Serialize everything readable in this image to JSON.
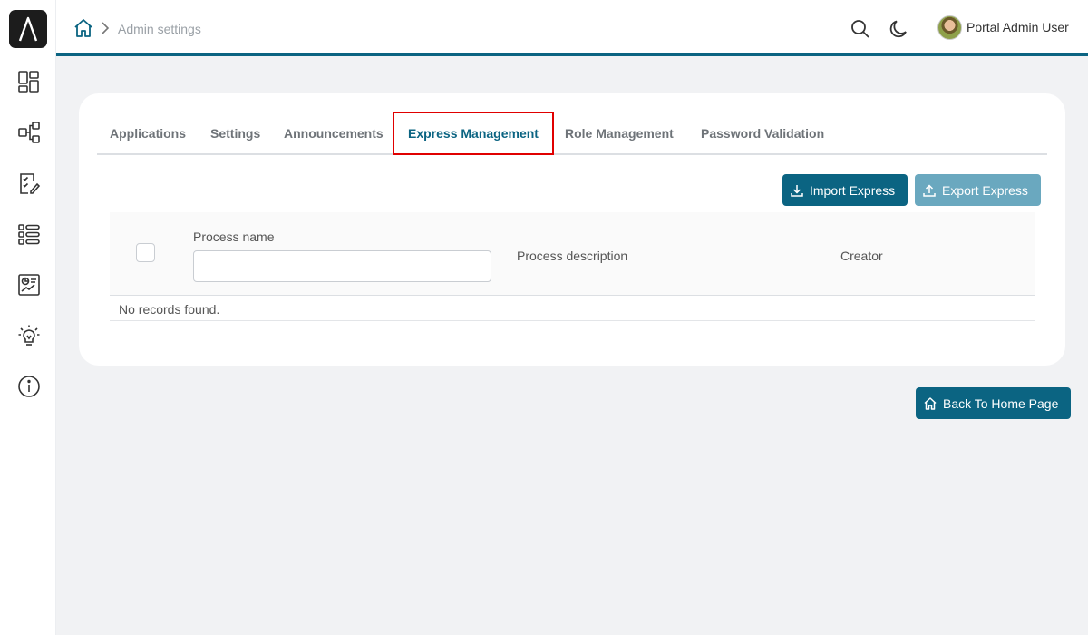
{
  "sidebar": {
    "logo_icon": "lambda-logo-icon",
    "items": [
      {
        "icon": "dashboard-icon"
      },
      {
        "icon": "process-flow-icon"
      },
      {
        "icon": "task-checklist-icon"
      },
      {
        "icon": "list-icon"
      },
      {
        "icon": "statistics-icon"
      },
      {
        "icon": "lightbulb-icon"
      },
      {
        "icon": "info-icon"
      }
    ]
  },
  "header": {
    "breadcrumb": "Admin settings",
    "user_name": "Portal Admin User",
    "accent_color": "#0b6482"
  },
  "tabs": [
    {
      "label": "Applications",
      "active": false
    },
    {
      "label": "Settings",
      "active": false
    },
    {
      "label": "Announcements",
      "active": false
    },
    {
      "label": "Express Management",
      "active": true
    },
    {
      "label": "Role Management",
      "active": false
    },
    {
      "label": "Password Validation",
      "active": false
    }
  ],
  "toolbar": {
    "import_label": "Import Express",
    "export_label": "Export Express"
  },
  "table": {
    "columns": {
      "name": "Process name",
      "description": "Process description",
      "creator": "Creator"
    },
    "name_filter_value": "",
    "empty_message": "No records found."
  },
  "footer": {
    "back_label": "Back To Home Page"
  }
}
